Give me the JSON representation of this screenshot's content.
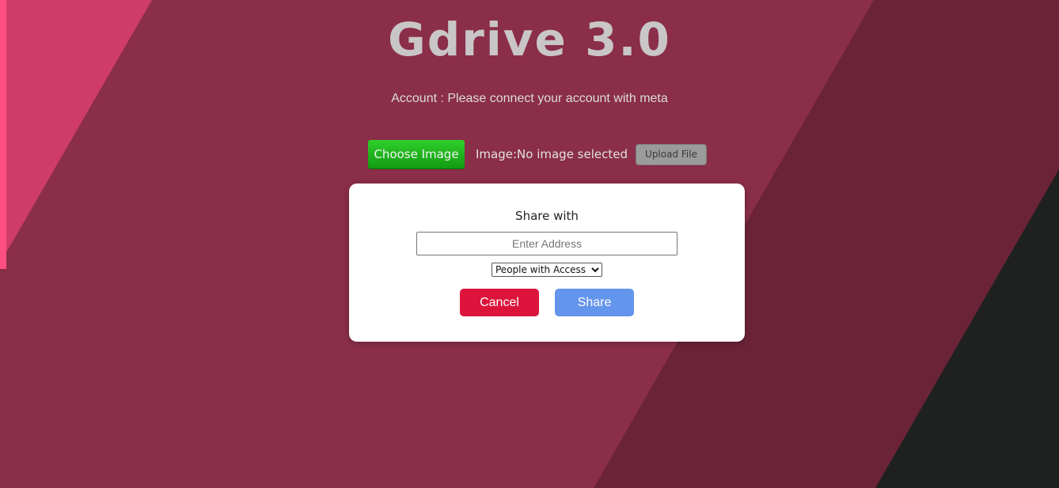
{
  "header": {
    "title": "Gdrive 3.0",
    "account_text": "Account : Please connect your account with meta"
  },
  "upload": {
    "choose_label": "Choose Image",
    "status_text": "Image:No image selected",
    "upload_label": "Upload File"
  },
  "share_dialog": {
    "title": "Share with",
    "address_placeholder": "Enter Address",
    "access_selected": "People with Access",
    "cancel_label": "Cancel",
    "share_label": "Share"
  },
  "colors": {
    "background_main": "#8a2e49",
    "background_dark": "#6b2338",
    "background_pink": "#cf3c6a",
    "background_edge": "#ff4f81",
    "background_corner": "#1f2120",
    "cancel_button": "#dc143c",
    "share_button": "#6495ed",
    "choose_button": "#22b81f"
  }
}
